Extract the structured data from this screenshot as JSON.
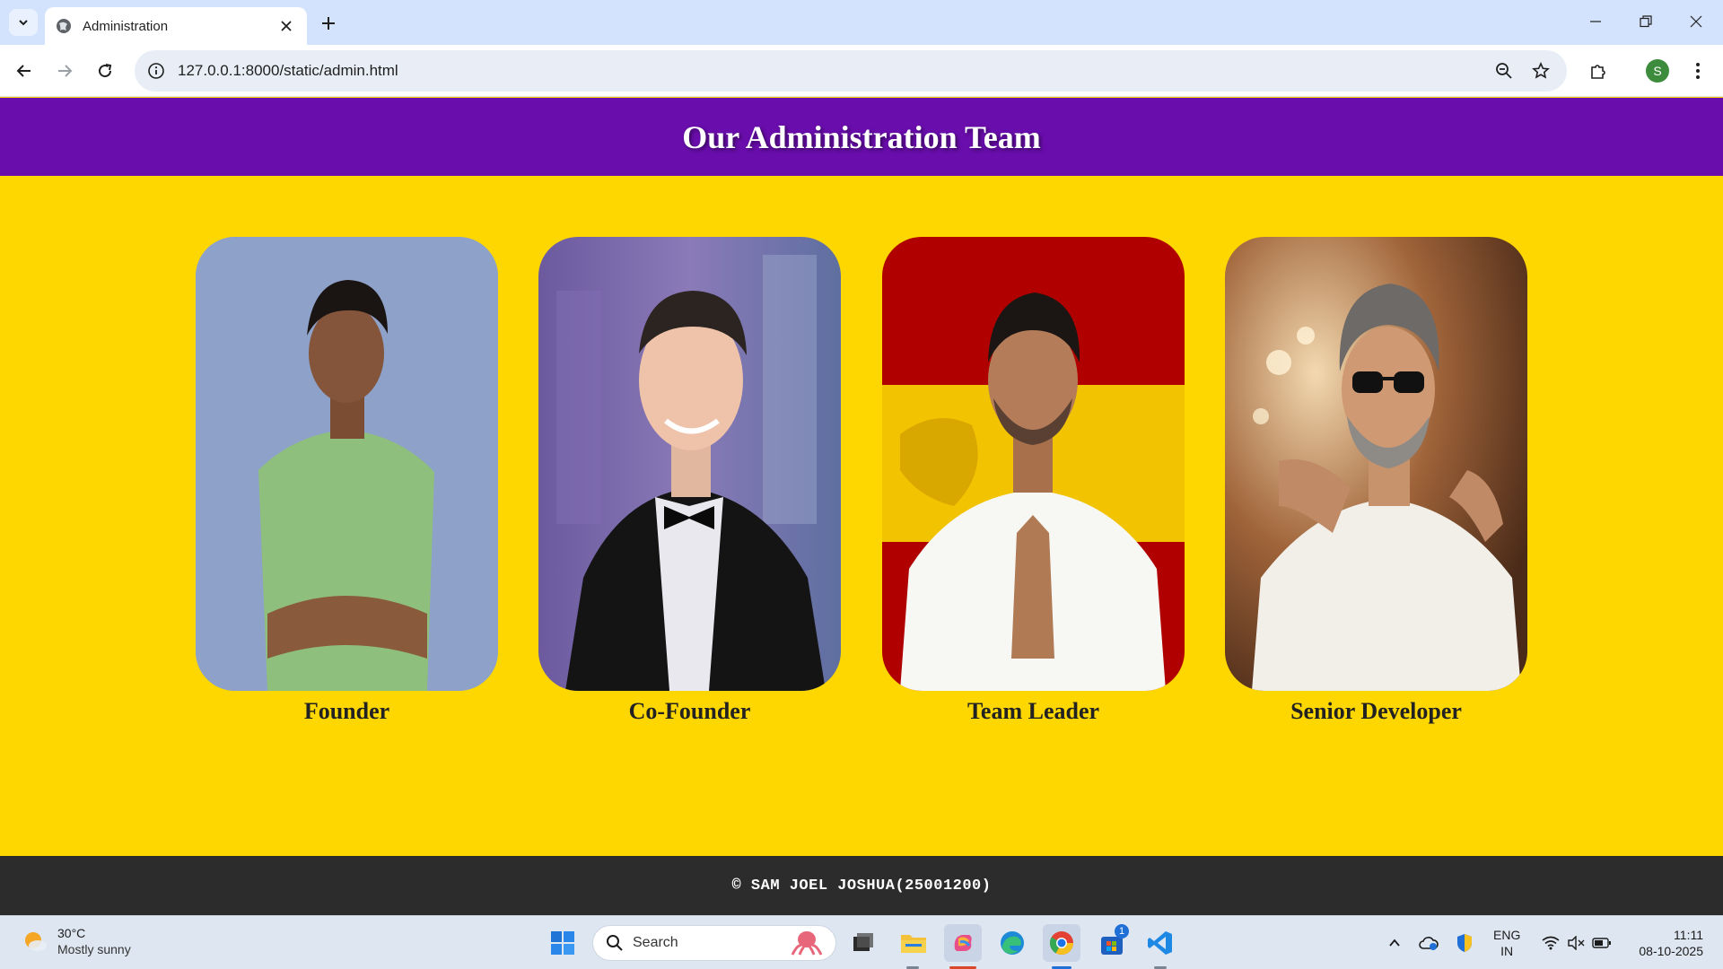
{
  "browser": {
    "tab_title": "Administration",
    "url": "127.0.0.1:8000/static/admin.html",
    "profile_initial": "S"
  },
  "page": {
    "heading": "Our Administration Team",
    "members": [
      {
        "role": "Founder"
      },
      {
        "role": "Co-Founder"
      },
      {
        "role": "Team Leader"
      },
      {
        "role": "Senior Developer"
      }
    ],
    "footer": "© SAM JOEL JOSHUA(25001200)",
    "colors": {
      "header_bg": "#6a0dad",
      "content_bg": "#ffd700",
      "footer_bg": "#2c2c2c"
    }
  },
  "taskbar": {
    "weather_temp": "30°C",
    "weather_desc": "Mostly sunny",
    "search_label": "Search",
    "lang_top": "ENG",
    "lang_bottom": "IN",
    "time": "11:11",
    "date": "08-10-2025",
    "store_badge": "1"
  }
}
